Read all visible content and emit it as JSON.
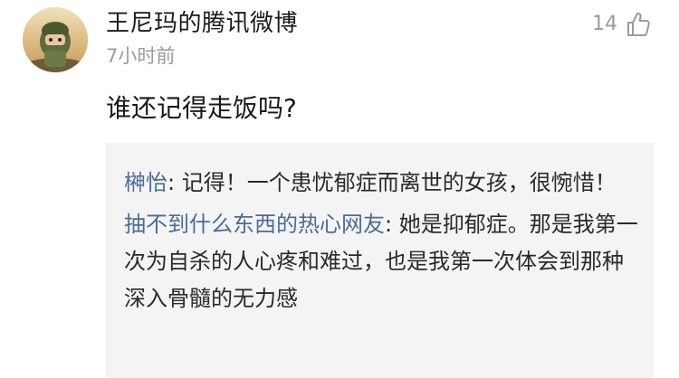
{
  "comment": {
    "author": "王尼玛的腾讯微博",
    "time": "7小时前",
    "like_count": "14",
    "like_icon": "thumbs-up-icon",
    "text": "谁还记得走饭吗?"
  },
  "replies": [
    {
      "user": "榊怡",
      "separator": ": ",
      "text": "记得！一个患忧郁症而离世的女孩，很惋惜！"
    },
    {
      "user": "抽不到什么东西的热心网友",
      "separator": ": ",
      "text": "她是抑郁症。那是我第一次为自杀的人心疼和难过，也是我第一次体会到那种深入骨髓的无力感"
    }
  ]
}
